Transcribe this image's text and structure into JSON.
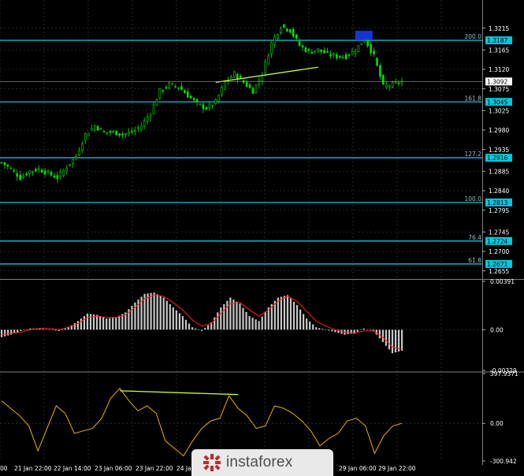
{
  "chart_data": [
    {
      "type": "candlestick",
      "panel": "price",
      "ylim": [
        1.264,
        1.324
      ],
      "price_ticks": [
        "1.3215",
        "1.3165",
        "1.3120",
        "1.3075",
        "1.3025",
        "1.2980",
        "1.2935",
        "1.2885",
        "1.2840",
        "1.2795",
        "1.2745",
        "1.2700",
        "1.2655"
      ],
      "current_price": "1.3092",
      "fib_levels": [
        {
          "label": "200.0",
          "value": "1.3187"
        },
        {
          "label": "161.8",
          "value": "1.3045"
        },
        {
          "label": "127.2",
          "value": "1.2916"
        },
        {
          "label": "100.0",
          "value": "1.2813"
        },
        {
          "label": "76.4",
          "value": "1.2724"
        },
        {
          "label": "61.8",
          "value": "1.2671"
        }
      ],
      "close_series": [
        1.2905,
        1.289,
        1.287,
        1.2885,
        1.289,
        1.288,
        1.287,
        1.2895,
        1.292,
        1.297,
        1.299,
        1.2975,
        1.2975,
        1.297,
        1.2975,
        1.299,
        1.302,
        1.307,
        1.3085,
        1.308,
        1.306,
        1.304,
        1.303,
        1.3045,
        1.309,
        1.311,
        1.309,
        1.307,
        1.311,
        1.318,
        1.322,
        1.321,
        1.3175,
        1.316,
        1.3165,
        1.3155,
        1.315,
        1.315,
        1.3165,
        1.319,
        1.315,
        1.308,
        1.3085,
        1.3092
      ],
      "trendline": [
        [
          23,
          1.309
        ],
        [
          34,
          1.3125
        ]
      ],
      "x_ticks": [
        "00",
        "21 Jan 22:00",
        "22 Jan 14:00",
        "23 Jan 06:00",
        "23 Jan 22:00",
        "24 Jan",
        "29 Jan 06:00",
        "29 Jan 22:00"
      ]
    },
    {
      "type": "histogram",
      "panel": "macd",
      "ylim": [
        -0.00329,
        0.00391
      ],
      "ticks": [
        "0.00391",
        "0.00",
        "-0.00329"
      ],
      "macd": [
        -0.0006,
        -0.0004,
        -0.0001,
        0.0001,
        0.0001,
        0.0,
        -0.0001,
        0.0002,
        0.0007,
        0.0013,
        0.0012,
        0.0009,
        0.001,
        0.0014,
        0.0022,
        0.0029,
        0.003,
        0.0026,
        0.0018,
        0.0011,
        0.0002,
        -0.0001,
        0.0006,
        0.0018,
        0.0026,
        0.0021,
        0.0011,
        0.0007,
        0.0018,
        0.0026,
        0.0028,
        0.002,
        0.0009,
        0.0002,
        0.0,
        -0.0002,
        -0.0004,
        -0.0003,
        0.0001,
        -0.0001,
        -0.001,
        -0.0019,
        -0.0017
      ],
      "signal": [
        -0.0004,
        -0.0003,
        -0.0002,
        0.0,
        0.0001,
        0.0001,
        0.0,
        0.0002,
        0.0005,
        0.001,
        0.0011,
        0.001,
        0.001,
        0.0012,
        0.0018,
        0.0025,
        0.0028,
        0.0027,
        0.0022,
        0.0016,
        0.0008,
        0.0003,
        0.0005,
        0.0013,
        0.0021,
        0.0022,
        0.0016,
        0.0011,
        0.0016,
        0.0023,
        0.0027,
        0.0023,
        0.0015,
        0.0007,
        0.0003,
        0.0,
        -0.0002,
        -0.0003,
        -0.0001,
        -0.0001,
        -0.0006,
        -0.0014,
        -0.0016
      ]
    },
    {
      "type": "line",
      "panel": "oscillator",
      "ylim": [
        -300.942,
        397.937
      ],
      "ticks": [
        "397.9371",
        "0.00",
        "-300.942"
      ],
      "values": [
        180,
        120,
        60,
        -20,
        -220,
        -40,
        140,
        80,
        -80,
        -60,
        -40,
        40,
        200,
        280,
        180,
        100,
        140,
        80,
        -140,
        -200,
        -260,
        -140,
        -40,
        20,
        40,
        220,
        120,
        60,
        -40,
        -20,
        140,
        120,
        80,
        20,
        -60,
        -180,
        -120,
        -80,
        20,
        40,
        -20,
        -240,
        -100,
        -20,
        0
      ],
      "trendline": [
        [
          13,
          260
        ],
        [
          26,
          230
        ]
      ]
    }
  ],
  "logo": {
    "text": "instaforex",
    "icon": "instaforex-logo-icon"
  },
  "colors": {
    "background": "#000000",
    "candle": "#00e000",
    "fib": "#00c8dc",
    "grid": "#3a4a55",
    "histogram": "#c8c8c8",
    "signal": "#ff2020",
    "oscillator": "#e5b000",
    "trendline": "#c8ff30"
  }
}
